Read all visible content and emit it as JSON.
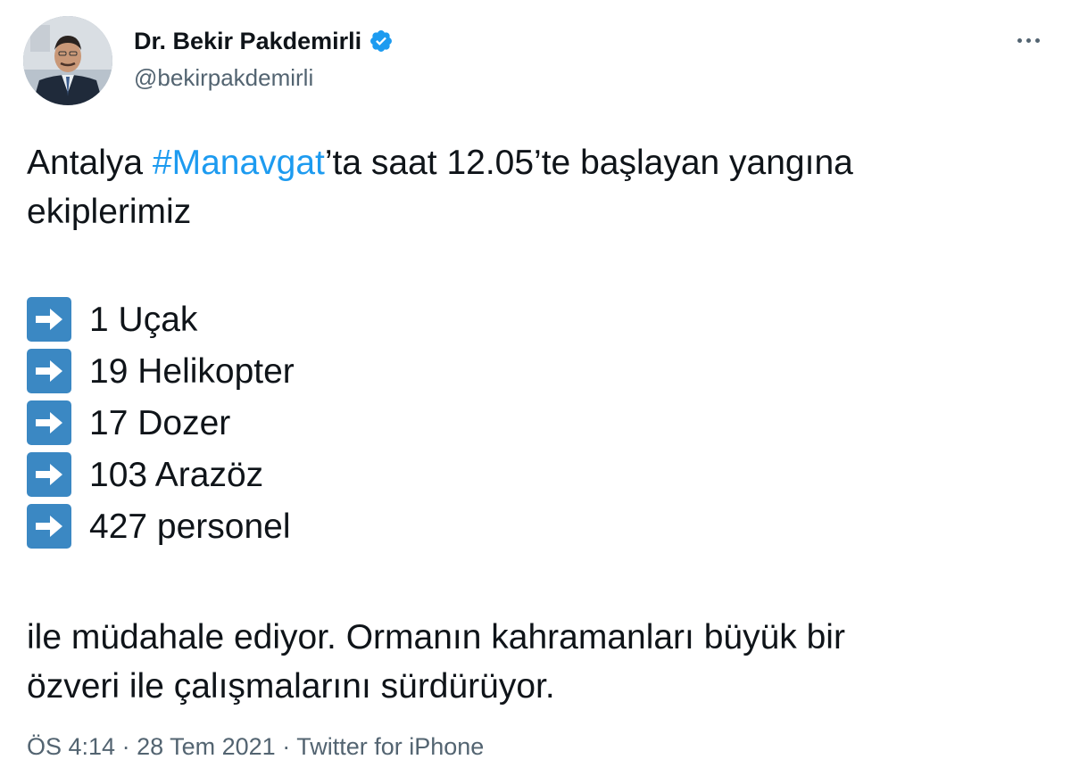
{
  "author": {
    "display_name": "Dr. Bekir Pakdemirli",
    "handle": "@bekirpakdemirli"
  },
  "tweet": {
    "intro_prefix": "Antalya ",
    "hashtag": "#Manavgat",
    "intro_suffix": "’ta saat 12.05’te başlayan yangına",
    "intro_line2": "ekiplerimiz",
    "items": [
      {
        "icon": "right-arrow-emoji-icon",
        "text": "1 Uçak"
      },
      {
        "icon": "right-arrow-emoji-icon",
        "text": "19 Helikopter"
      },
      {
        "icon": "right-arrow-emoji-icon",
        "text": "17 Dozer"
      },
      {
        "icon": "right-arrow-emoji-icon",
        "text": "103 Arazöz"
      },
      {
        "icon": "right-arrow-emoji-icon",
        "text": "427 personel"
      }
    ],
    "closing_line1": "ile müdahale ediyor. Ormanın kahramanları büyük bir",
    "closing_line2": "özveri ile çalışmalarını sürdürüyor."
  },
  "meta": {
    "time": "ÖS 4:14",
    "separator1": " · ",
    "date": "28 Tem 2021",
    "separator2": " · ",
    "source": "Twitter for iPhone"
  },
  "colors": {
    "link": "#1d9bf0",
    "secondary_text": "#536471",
    "verified_badge": "#1d9bf0",
    "arrow_box": "#3b88c3"
  }
}
